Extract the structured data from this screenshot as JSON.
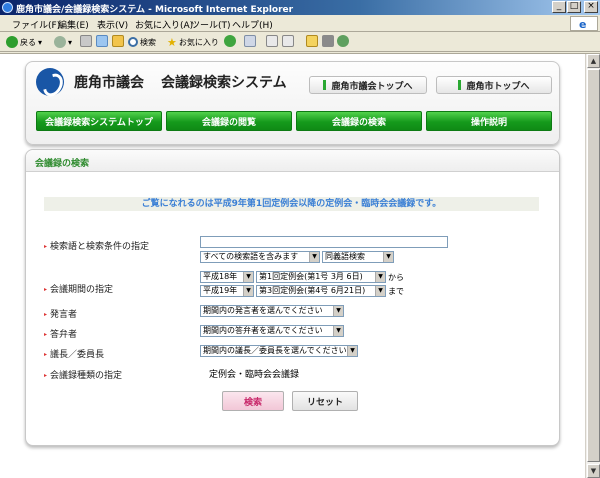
{
  "window": {
    "title": "鹿角市議会/会議録検索システム - Microsoft Internet Explorer",
    "minimize": "_",
    "maximize": "□",
    "close": "×"
  },
  "menubar": {
    "items": [
      "ファイル(F)",
      "編集(E)",
      "表示(V)",
      "お気に入り(A)",
      "ツール(T)",
      "ヘルプ(H)"
    ]
  },
  "toolbar": {
    "back": "戻る",
    "search": "検索",
    "favorites": "お気に入り"
  },
  "header": {
    "org_name": "鹿角市議会",
    "system_name": "会議録検索システム",
    "link_council_top": "鹿角市議会トップへ",
    "link_city_top": "鹿角市トップへ",
    "nav": [
      "会議録検索システムトップ",
      "会議録の閲覧",
      "会議録の検索",
      "操作説明"
    ]
  },
  "search_panel": {
    "heading": "会議録の検索",
    "notice": "ご覧になれるのは平成9年第1回定例会以降の定例会・臨時会会議録です。",
    "keyword": {
      "label": "検索語と検索条件の指定",
      "value": "",
      "condition": "すべての検索語を含みます",
      "synonym": "同義語検索"
    },
    "period": {
      "label": "会議期間の指定",
      "from_year": "平成18年",
      "from_session": "第1回定例会(第1号 3月 6日)",
      "from_suffix": "から",
      "to_year": "平成19年",
      "to_session": "第3回定例会(第4号 6月21日)",
      "to_suffix": "まで"
    },
    "speaker": {
      "label": "発言者",
      "value": "期間内の発言者を選んでください"
    },
    "answerer": {
      "label": "答弁者",
      "value": "期間内の答弁者を選んでください"
    },
    "chair": {
      "label": "議長／委員長",
      "value": "期間内の議長／委員長を選んでください"
    },
    "record_type": {
      "label": "会議録種類の指定",
      "value": "定例会・臨時会会議録"
    },
    "buttons": {
      "search": "検索",
      "reset": "リセット"
    }
  }
}
